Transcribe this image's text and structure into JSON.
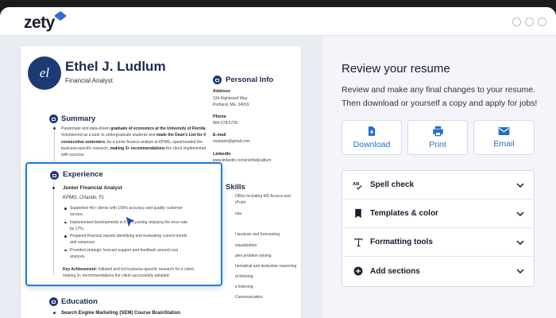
{
  "brand": {
    "logo_text": "zety"
  },
  "colors": {
    "accent": "#1f6fd1",
    "resume_navy": "#1d3b73",
    "selection_blue": "#1f7ad9"
  },
  "resume": {
    "initials": "el",
    "name": "Ethel J. Ludlum",
    "title": "Financial Analyst",
    "summary": {
      "heading": "Summary",
      "parts": [
        {
          "t": "Passionate and data-driven ",
          "b": false
        },
        {
          "t": "graduate of economics at the University of Florida",
          "b": true
        },
        {
          "t": ". Volunteered as a tutor to undergraduate students and ",
          "b": false
        },
        {
          "t": "made the Dean's List for 4 consecutive semesters.",
          "b": true
        },
        {
          "t": " As a junior finance analyst at KPMG, spearheaded the business-specific research, ",
          "b": false
        },
        {
          "t": "making 3+ recommendations",
          "b": true
        },
        {
          "t": " the client implemented with success.",
          "b": false
        }
      ]
    },
    "personal_info": {
      "heading": "Personal Info",
      "address_label": "Address",
      "address_line1": "134 Rightward Way",
      "address_line2": "Portland, ME, 04019",
      "phone_label": "Phone",
      "phone": "804-278-5735",
      "email_label": "E-mail",
      "email": "example@gmail.com",
      "linkedin_label": "LinkedIn",
      "linkedin": "www.linkedin.com/in/ethelj/udlum"
    },
    "skills": {
      "heading": "Skills",
      "items": [
        "Office including MS Access and",
        "rPoint",
        "eau",
        "l analysis and forecasting",
        "visualization",
        "plex problem solving",
        "hematical and deductive reasoning",
        "al thinking",
        "e listening",
        "Communication"
      ]
    },
    "experience": {
      "heading": "Experience",
      "job_title": "Junior Financial Analyst",
      "company": "KPMG, Orlando, FL",
      "bullets": [
        "Supported 40+ clients with 100% accuracy and quality customer service.",
        "Implemented developments in KPI reporting reducing the error rate by 17%.",
        "Prepared financial reports identifying and evaluating current trends and variances.",
        "Provided strategic forecast support and feedback around cost analysis."
      ],
      "achievement_label": "Key Achievement:",
      "achievement_text": " Initiated and led business-specific research for a client, making 3+ recommendations the client successfully adopted."
    },
    "education": {
      "heading": "Education",
      "item": "Search Engine Marketing (SEM) Course BrainStation"
    }
  },
  "review": {
    "title": "Review your resume",
    "description": "Review and make any final changes to your resume. Then download or yourself a copy and apply for jobs!",
    "actions": [
      {
        "label": "Download",
        "icon": "download-icon"
      },
      {
        "label": "Print",
        "icon": "print-icon"
      },
      {
        "label": "Email",
        "icon": "email-icon"
      }
    ],
    "accordion": [
      {
        "label": "Spell check",
        "icon": "spell-check-icon"
      },
      {
        "label": "Templates & color",
        "icon": "bookmark-icon"
      },
      {
        "label": "Formatting tools",
        "icon": "format-icon"
      },
      {
        "label": "Add sections",
        "icon": "plus-circle-icon"
      }
    ]
  }
}
